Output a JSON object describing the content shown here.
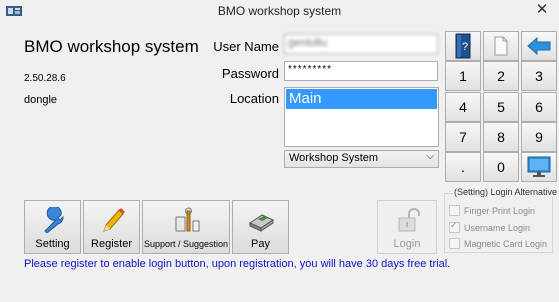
{
  "window": {
    "title": "BMO workshop system"
  },
  "app": {
    "name": "BMO workshop system",
    "version": "2.50.28.6",
    "license": "dongle"
  },
  "form": {
    "username_label": "User Name",
    "username_value": "gentoltu",
    "password_label": "Password",
    "password_value": "*********",
    "location_label": "Location",
    "locations": [
      "Main"
    ],
    "system_select": "Workshop System"
  },
  "keypad": {
    "keys": [
      "1",
      "2",
      "3",
      "4",
      "5",
      "6",
      "7",
      "8",
      "9",
      ".",
      "0"
    ]
  },
  "buttons": {
    "setting": "Setting",
    "register": "Register",
    "support": "Support / Suggestion",
    "pay": "Pay",
    "login": "Login"
  },
  "alt_login": {
    "title": "(Setting) Login Alternative",
    "options": [
      {
        "label": "Finger Print Login",
        "checked": false
      },
      {
        "label": "Username Login",
        "checked": true
      },
      {
        "label": "Magnetic Card Login",
        "checked": false
      }
    ]
  },
  "message": "Please register to enable login button, upon registration, you will have 30 days free trial.",
  "colors": {
    "selection": "#3399ff",
    "message": "#1212c8",
    "arrow": "#2f8fd8"
  }
}
